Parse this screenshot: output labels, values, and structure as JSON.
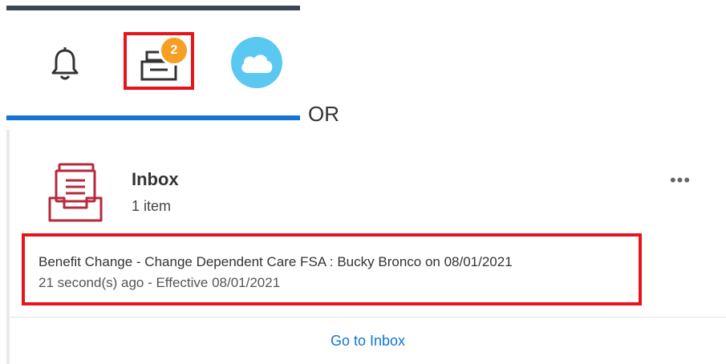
{
  "header": {
    "badge_count": "2",
    "divider_label": "OR",
    "colors": {
      "badge": "#f5a023",
      "avatar": "#5bc8f2",
      "accent": "#1373d6",
      "highlight": "#e8141c"
    },
    "icons": [
      "bell-icon",
      "inbox-tray-icon",
      "cloud-avatar-icon"
    ]
  },
  "inbox": {
    "title": "Inbox",
    "count": "1 item",
    "more": "•••",
    "icon": "inbox-stack-icon",
    "items": [
      {
        "title": "Benefit Change - Change Dependent Care FSA : Bucky Bronco on 08/01/2021",
        "subtitle": "21 second(s) ago - Effective 08/01/2021"
      }
    ],
    "footer_link": "Go to Inbox"
  }
}
